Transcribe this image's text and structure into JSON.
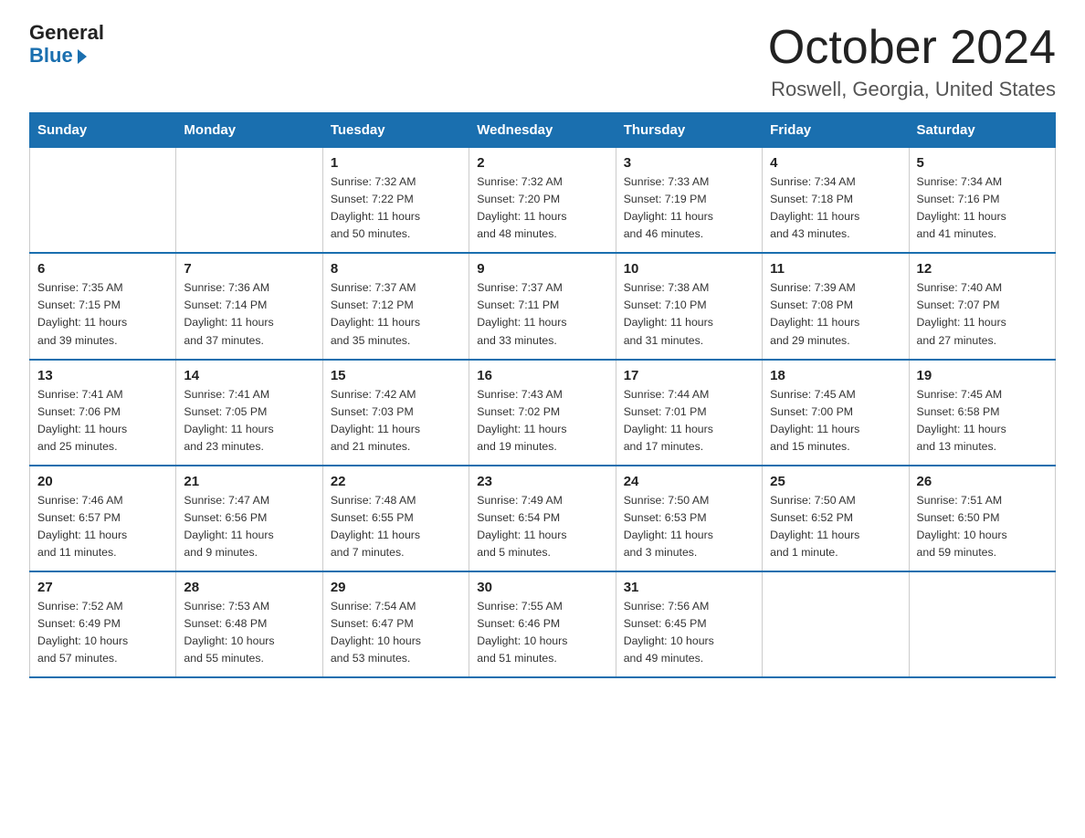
{
  "header": {
    "logo_general": "General",
    "logo_blue": "Blue",
    "month": "October 2024",
    "location": "Roswell, Georgia, United States"
  },
  "days_of_week": [
    "Sunday",
    "Monday",
    "Tuesday",
    "Wednesday",
    "Thursday",
    "Friday",
    "Saturday"
  ],
  "weeks": [
    [
      {
        "day": "",
        "info": ""
      },
      {
        "day": "",
        "info": ""
      },
      {
        "day": "1",
        "info": "Sunrise: 7:32 AM\nSunset: 7:22 PM\nDaylight: 11 hours\nand 50 minutes."
      },
      {
        "day": "2",
        "info": "Sunrise: 7:32 AM\nSunset: 7:20 PM\nDaylight: 11 hours\nand 48 minutes."
      },
      {
        "day": "3",
        "info": "Sunrise: 7:33 AM\nSunset: 7:19 PM\nDaylight: 11 hours\nand 46 minutes."
      },
      {
        "day": "4",
        "info": "Sunrise: 7:34 AM\nSunset: 7:18 PM\nDaylight: 11 hours\nand 43 minutes."
      },
      {
        "day": "5",
        "info": "Sunrise: 7:34 AM\nSunset: 7:16 PM\nDaylight: 11 hours\nand 41 minutes."
      }
    ],
    [
      {
        "day": "6",
        "info": "Sunrise: 7:35 AM\nSunset: 7:15 PM\nDaylight: 11 hours\nand 39 minutes."
      },
      {
        "day": "7",
        "info": "Sunrise: 7:36 AM\nSunset: 7:14 PM\nDaylight: 11 hours\nand 37 minutes."
      },
      {
        "day": "8",
        "info": "Sunrise: 7:37 AM\nSunset: 7:12 PM\nDaylight: 11 hours\nand 35 minutes."
      },
      {
        "day": "9",
        "info": "Sunrise: 7:37 AM\nSunset: 7:11 PM\nDaylight: 11 hours\nand 33 minutes."
      },
      {
        "day": "10",
        "info": "Sunrise: 7:38 AM\nSunset: 7:10 PM\nDaylight: 11 hours\nand 31 minutes."
      },
      {
        "day": "11",
        "info": "Sunrise: 7:39 AM\nSunset: 7:08 PM\nDaylight: 11 hours\nand 29 minutes."
      },
      {
        "day": "12",
        "info": "Sunrise: 7:40 AM\nSunset: 7:07 PM\nDaylight: 11 hours\nand 27 minutes."
      }
    ],
    [
      {
        "day": "13",
        "info": "Sunrise: 7:41 AM\nSunset: 7:06 PM\nDaylight: 11 hours\nand 25 minutes."
      },
      {
        "day": "14",
        "info": "Sunrise: 7:41 AM\nSunset: 7:05 PM\nDaylight: 11 hours\nand 23 minutes."
      },
      {
        "day": "15",
        "info": "Sunrise: 7:42 AM\nSunset: 7:03 PM\nDaylight: 11 hours\nand 21 minutes."
      },
      {
        "day": "16",
        "info": "Sunrise: 7:43 AM\nSunset: 7:02 PM\nDaylight: 11 hours\nand 19 minutes."
      },
      {
        "day": "17",
        "info": "Sunrise: 7:44 AM\nSunset: 7:01 PM\nDaylight: 11 hours\nand 17 minutes."
      },
      {
        "day": "18",
        "info": "Sunrise: 7:45 AM\nSunset: 7:00 PM\nDaylight: 11 hours\nand 15 minutes."
      },
      {
        "day": "19",
        "info": "Sunrise: 7:45 AM\nSunset: 6:58 PM\nDaylight: 11 hours\nand 13 minutes."
      }
    ],
    [
      {
        "day": "20",
        "info": "Sunrise: 7:46 AM\nSunset: 6:57 PM\nDaylight: 11 hours\nand 11 minutes."
      },
      {
        "day": "21",
        "info": "Sunrise: 7:47 AM\nSunset: 6:56 PM\nDaylight: 11 hours\nand 9 minutes."
      },
      {
        "day": "22",
        "info": "Sunrise: 7:48 AM\nSunset: 6:55 PM\nDaylight: 11 hours\nand 7 minutes."
      },
      {
        "day": "23",
        "info": "Sunrise: 7:49 AM\nSunset: 6:54 PM\nDaylight: 11 hours\nand 5 minutes."
      },
      {
        "day": "24",
        "info": "Sunrise: 7:50 AM\nSunset: 6:53 PM\nDaylight: 11 hours\nand 3 minutes."
      },
      {
        "day": "25",
        "info": "Sunrise: 7:50 AM\nSunset: 6:52 PM\nDaylight: 11 hours\nand 1 minute."
      },
      {
        "day": "26",
        "info": "Sunrise: 7:51 AM\nSunset: 6:50 PM\nDaylight: 10 hours\nand 59 minutes."
      }
    ],
    [
      {
        "day": "27",
        "info": "Sunrise: 7:52 AM\nSunset: 6:49 PM\nDaylight: 10 hours\nand 57 minutes."
      },
      {
        "day": "28",
        "info": "Sunrise: 7:53 AM\nSunset: 6:48 PM\nDaylight: 10 hours\nand 55 minutes."
      },
      {
        "day": "29",
        "info": "Sunrise: 7:54 AM\nSunset: 6:47 PM\nDaylight: 10 hours\nand 53 minutes."
      },
      {
        "day": "30",
        "info": "Sunrise: 7:55 AM\nSunset: 6:46 PM\nDaylight: 10 hours\nand 51 minutes."
      },
      {
        "day": "31",
        "info": "Sunrise: 7:56 AM\nSunset: 6:45 PM\nDaylight: 10 hours\nand 49 minutes."
      },
      {
        "day": "",
        "info": ""
      },
      {
        "day": "",
        "info": ""
      }
    ]
  ]
}
